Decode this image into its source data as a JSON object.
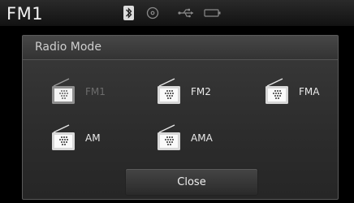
{
  "status": {
    "station": "FM1",
    "icons": [
      "bluetooth-icon",
      "disc-icon",
      "usb-icon",
      "battery-icon"
    ]
  },
  "dialog": {
    "title": "Radio Mode",
    "options": [
      {
        "label": "FM1",
        "icon": "radio-icon",
        "enabled": false
      },
      {
        "label": "FM2",
        "icon": "radio-icon",
        "enabled": true
      },
      {
        "label": "FMA",
        "icon": "radio-icon",
        "enabled": true
      },
      {
        "label": "AM",
        "icon": "radio-icon",
        "enabled": true
      },
      {
        "label": "AMA",
        "icon": "radio-icon",
        "enabled": true
      }
    ],
    "close_label": "Close"
  },
  "colors": {
    "background": "#000000",
    "panel": "#2e2e2e",
    "disabled_text": "#6c6c6c"
  }
}
